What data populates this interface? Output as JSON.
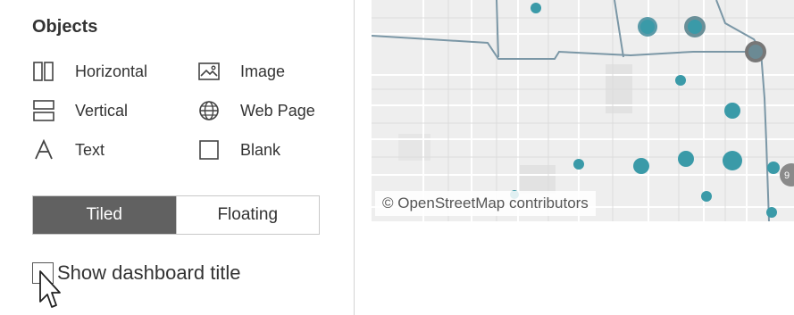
{
  "objects_panel": {
    "title": "Objects",
    "items": [
      {
        "label": "Horizontal",
        "icon": "horizontal-layout-icon"
      },
      {
        "label": "Image",
        "icon": "image-icon"
      },
      {
        "label": "Vertical",
        "icon": "vertical-layout-icon"
      },
      {
        "label": "Web Page",
        "icon": "globe-icon"
      },
      {
        "label": "Text",
        "icon": "text-icon"
      },
      {
        "label": "Blank",
        "icon": "blank-icon"
      }
    ]
  },
  "layout_toggle": {
    "tiled_label": "Tiled",
    "floating_label": "Floating",
    "selected": "Tiled"
  },
  "show_title": {
    "label": "Show dashboard title",
    "checked": false
  },
  "map": {
    "attribution": "© OpenStreetMap contributors",
    "marker_color": "#3a9aa8",
    "background_color": "#eeeeee"
  }
}
